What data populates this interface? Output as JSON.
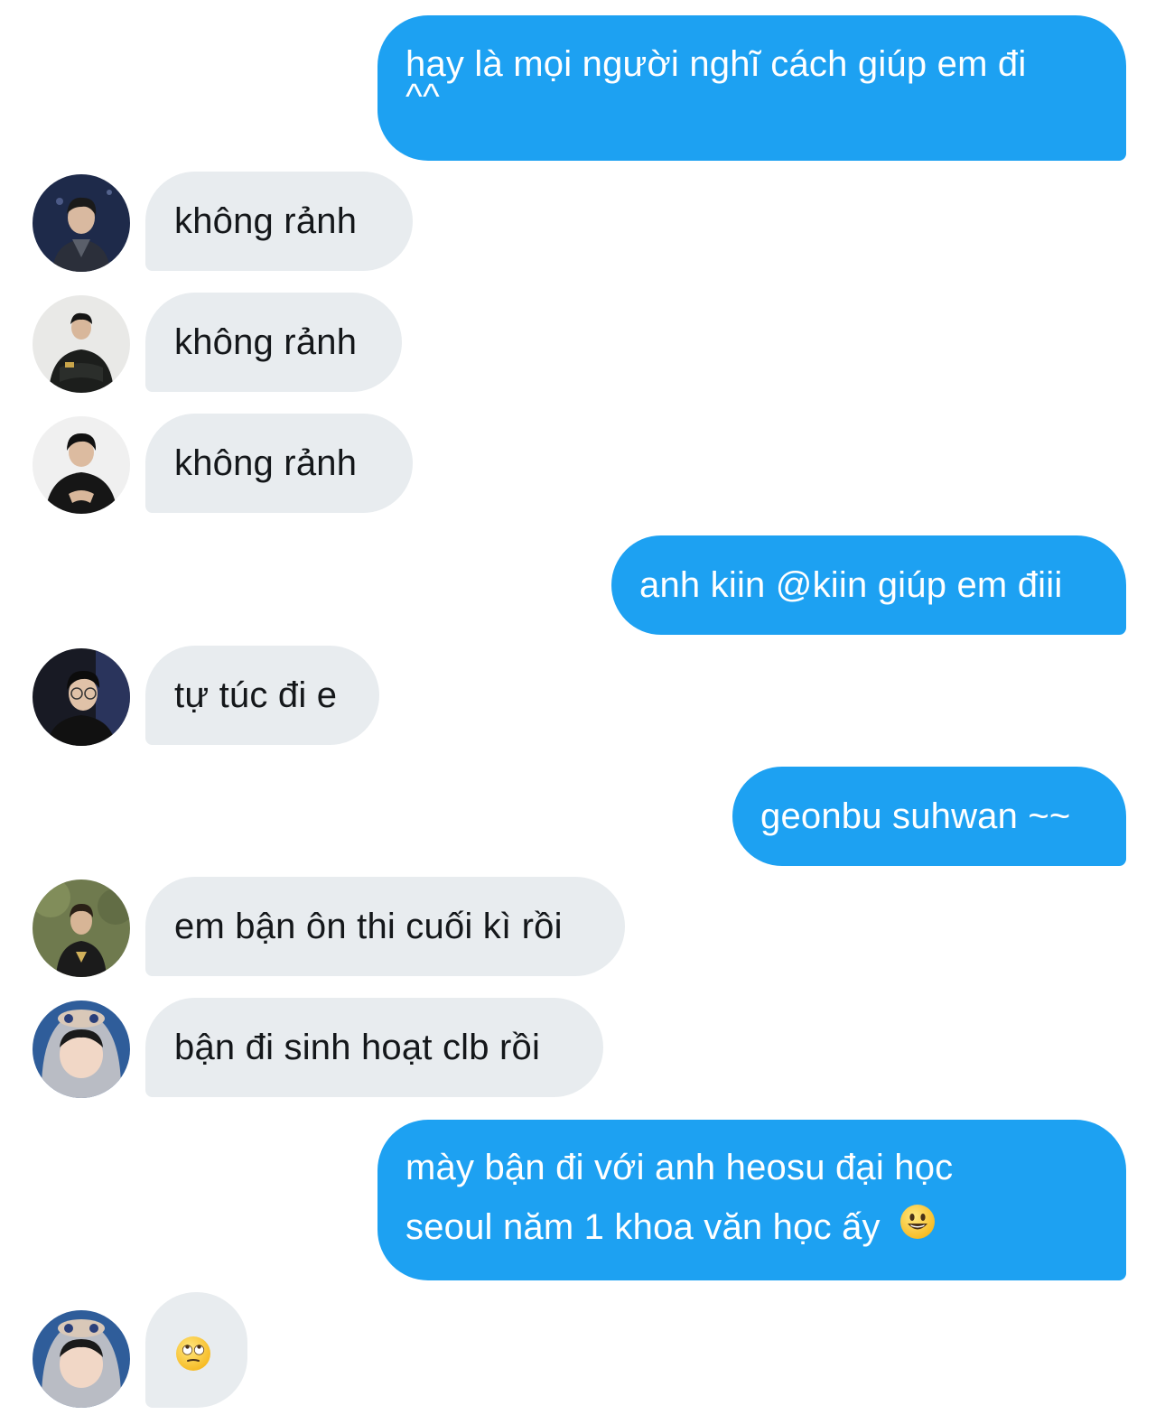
{
  "thread": {
    "messages": [
      {
        "side": "out",
        "lines": [
          "hay là mọi người nghĩ cách giúp em đi",
          "^^"
        ]
      },
      {
        "side": "in",
        "avatar": "avatar-1",
        "lines": [
          "không rảnh"
        ]
      },
      {
        "side": "in",
        "avatar": "avatar-2",
        "lines": [
          "không rảnh"
        ]
      },
      {
        "side": "in",
        "avatar": "avatar-3",
        "lines": [
          "không rảnh"
        ]
      },
      {
        "side": "out",
        "lines": [
          "anh kiin @kiin giúp em điii"
        ]
      },
      {
        "side": "in",
        "avatar": "avatar-4",
        "lines": [
          "tự túc đi e"
        ]
      },
      {
        "side": "out",
        "lines": [
          "geonbu suhwan ~~"
        ]
      },
      {
        "side": "in",
        "avatar": "avatar-5",
        "lines": [
          "em bận ôn thi cuối kì rồi"
        ]
      },
      {
        "side": "in",
        "avatar": "avatar-6",
        "lines": [
          "bận đi sinh hoạt clb rồi"
        ]
      },
      {
        "side": "out",
        "lines": [
          "mày bận đi với anh heosu đại học",
          "seoul năm 1 khoa văn học ấy"
        ],
        "trailing_emoji": "smiley-emoji"
      },
      {
        "side": "in",
        "avatar": "avatar-6",
        "lines": [],
        "emoji": "eye-roll-emoji"
      }
    ]
  },
  "colors": {
    "outgoing_bubble": "#1da1f2",
    "incoming_bubble": "#e8ecef",
    "outgoing_text": "#ffffff",
    "incoming_text": "#14171a",
    "background": "#ffffff"
  }
}
